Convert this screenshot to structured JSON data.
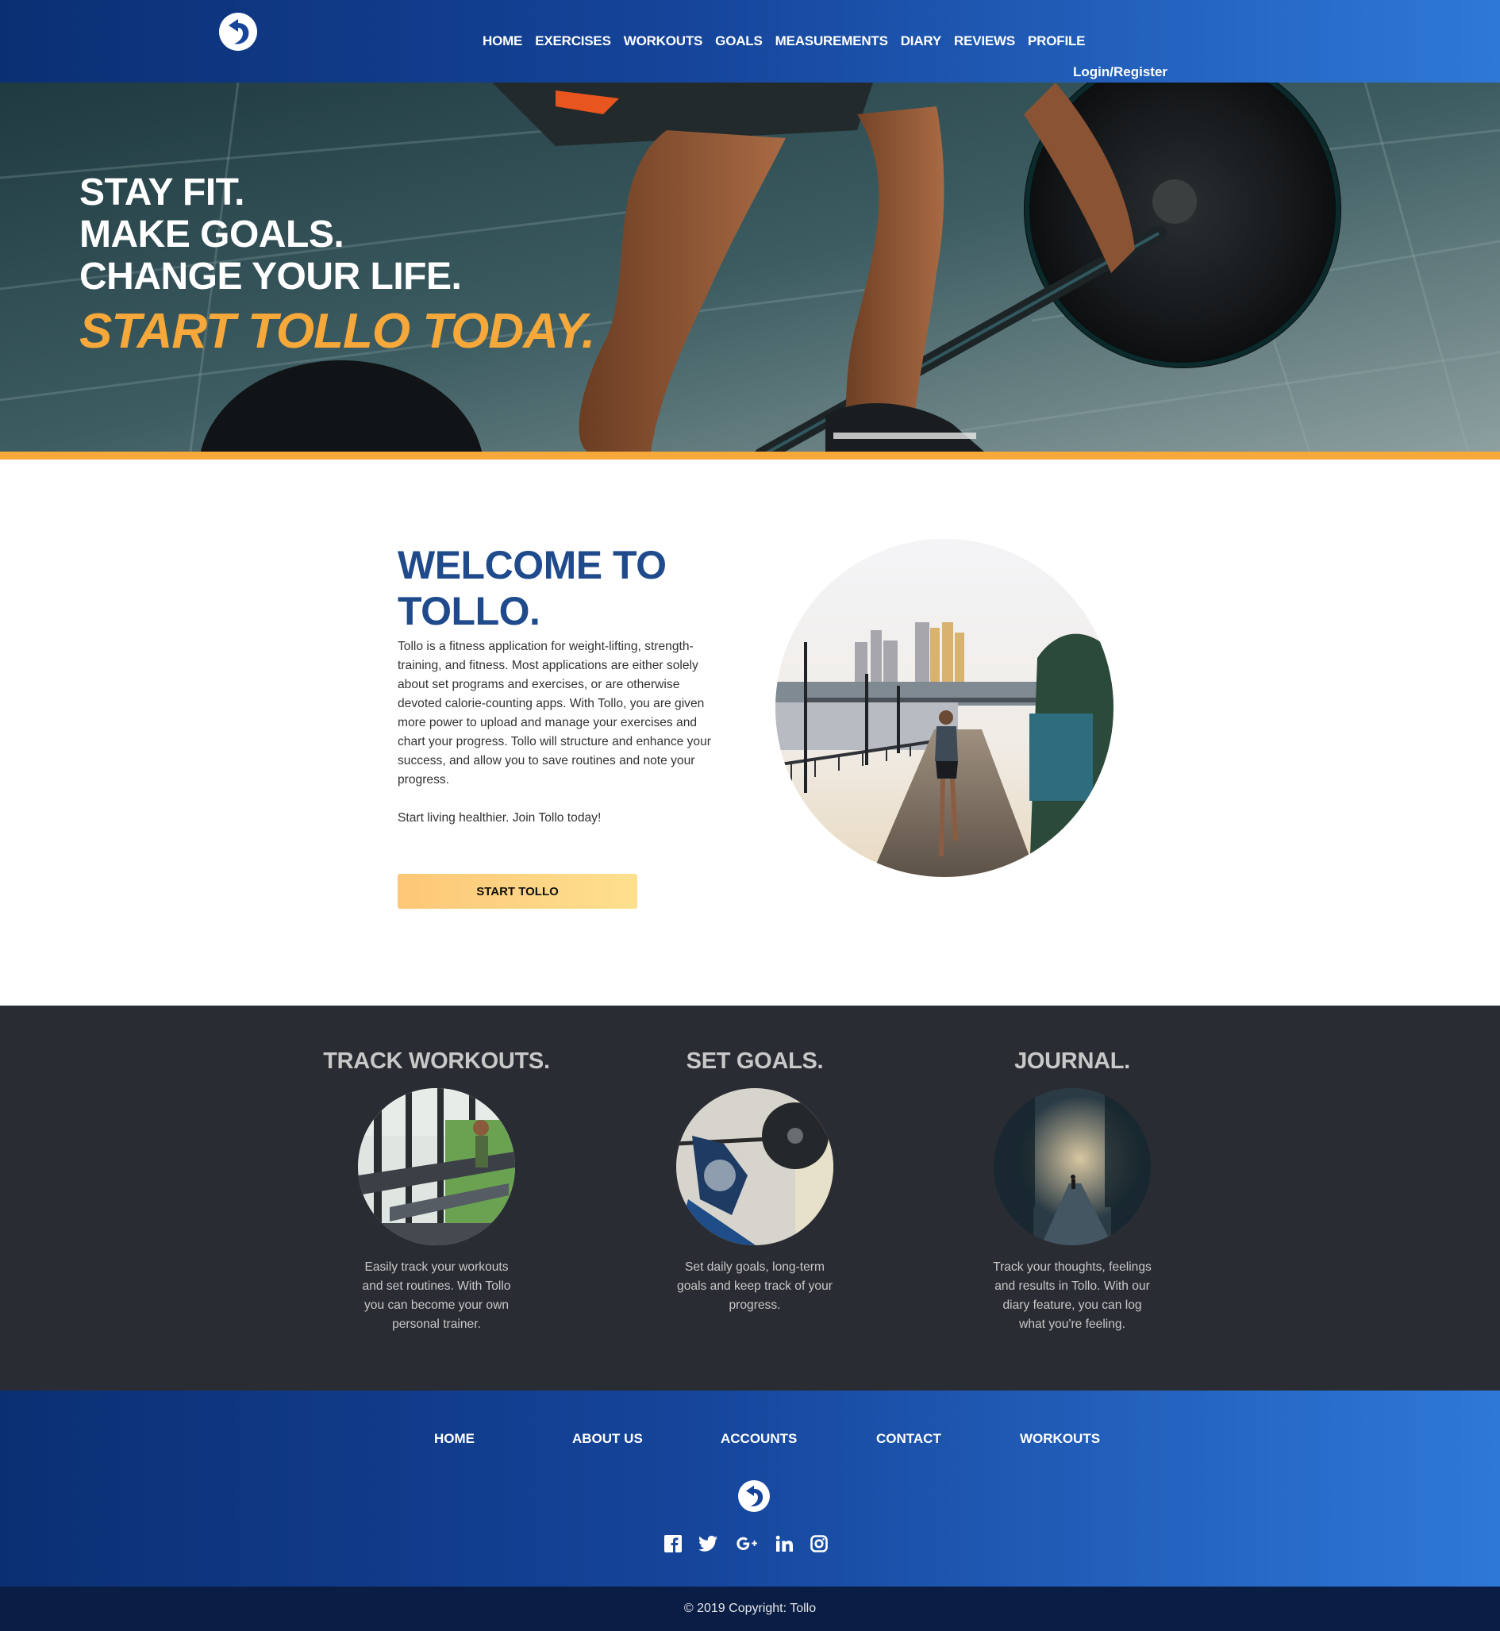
{
  "header": {
    "nav": [
      "HOME",
      "EXERCISES",
      "WORKOUTS",
      "GOALS",
      "MEASUREMENTS",
      "DIARY",
      "REVIEWS",
      "PROFILE"
    ],
    "login": "Login/Register"
  },
  "hero": {
    "line1": "STAY FIT.",
    "line2": "MAKE GOALS.",
    "line3": "CHANGE YOUR LIFE.",
    "cta": "START TOLLO TODAY."
  },
  "welcome": {
    "title": "WELCOME TO TOLLO.",
    "body": "Tollo is a fitness application for weight-lifting, strength-training, and fitness. Most applications are either solely about set programs and exercises, or are otherwise devoted calorie-counting apps. With Tollo, you are given more power to upload and manage your exercises and chart your progress. Tollo will structure and enhance your success, and allow you to save routines and note your progress.",
    "tagline": "Start living healthier. Join Tollo today!",
    "button": "START TOLLO"
  },
  "features": [
    {
      "title": "TRACK WORKOUTS.",
      "desc": "Easily track your workouts and set routines. With Tollo you can become your own personal trainer."
    },
    {
      "title": "SET GOALS.",
      "desc": "Set daily goals, long-term goals and keep track of your progress."
    },
    {
      "title": "JOURNAL.",
      "desc": "Track your thoughts, feelings and results in Tollo. With our diary feature, you can log what you're feeling."
    }
  ],
  "footer": {
    "nav": [
      "HOME",
      "ABOUT US",
      "ACCOUNTS",
      "CONTACT",
      "WORKOUTS"
    ],
    "social_icons": [
      "facebook-icon",
      "twitter-icon",
      "google-plus-icon",
      "linkedin-icon",
      "instagram-icon"
    ],
    "copyright": "© 2019 Copyright: Tollo"
  },
  "colors": {
    "brand_blue": "#15449a",
    "accent_orange": "#f6a83a",
    "title_blue": "#1f4a8c",
    "dark_section": "#292c32"
  }
}
